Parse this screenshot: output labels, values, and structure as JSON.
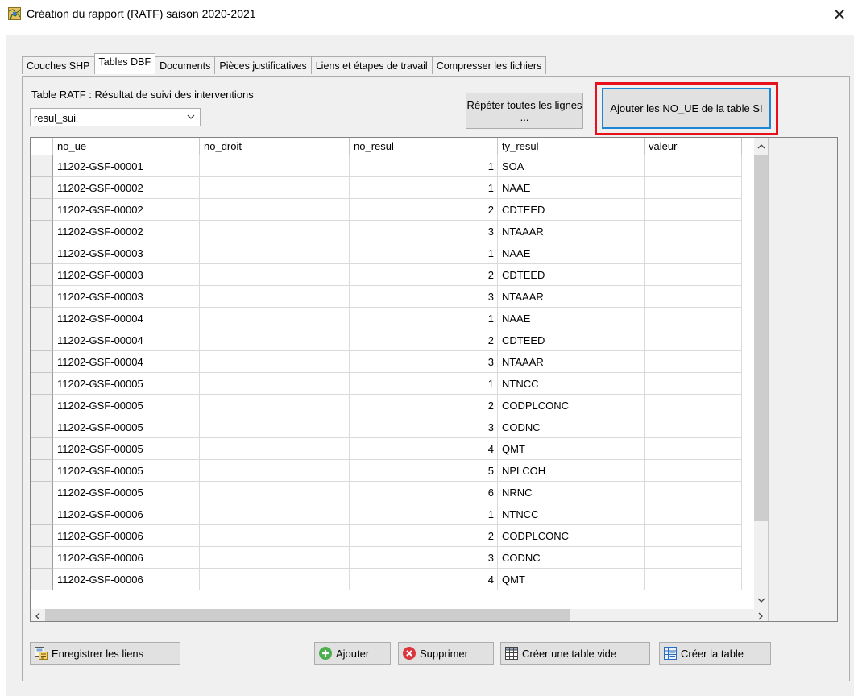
{
  "window": {
    "title": "Création du rapport (RATF)  saison 2020-2021",
    "icon": "app-map-icon",
    "close_glyph": "✕"
  },
  "tabs": [
    {
      "label": "Couches SHP",
      "active": false
    },
    {
      "label": "Tables DBF",
      "active": true
    },
    {
      "label": "Documents",
      "active": false
    },
    {
      "label": "Pièces justificatives",
      "active": false
    },
    {
      "label": "Liens et étapes de travail",
      "active": false
    },
    {
      "label": "Compresser les fichiers",
      "active": false
    }
  ],
  "panel": {
    "table_label": "Table RATF :  Résultat de suivi des interventions",
    "combo_value": "resul_sui",
    "repeat_button": "Répéter toutes les lignes ...",
    "add_noue_button": "Ajouter les NO_UE de la table SI",
    "highlight_color": "#e8101b"
  },
  "grid": {
    "columns": [
      "no_ue",
      "no_droit",
      "no_resul",
      "ty_resul",
      "valeur"
    ],
    "rows": [
      [
        "11202-GSF-00001",
        "",
        "1",
        "SOA",
        ""
      ],
      [
        "11202-GSF-00002",
        "",
        "1",
        "NAAE",
        ""
      ],
      [
        "11202-GSF-00002",
        "",
        "2",
        "CDTEED",
        ""
      ],
      [
        "11202-GSF-00002",
        "",
        "3",
        "NTAAAR",
        ""
      ],
      [
        "11202-GSF-00003",
        "",
        "1",
        "NAAE",
        ""
      ],
      [
        "11202-GSF-00003",
        "",
        "2",
        "CDTEED",
        ""
      ],
      [
        "11202-GSF-00003",
        "",
        "3",
        "NTAAAR",
        ""
      ],
      [
        "11202-GSF-00004",
        "",
        "1",
        "NAAE",
        ""
      ],
      [
        "11202-GSF-00004",
        "",
        "2",
        "CDTEED",
        ""
      ],
      [
        "11202-GSF-00004",
        "",
        "3",
        "NTAAAR",
        ""
      ],
      [
        "11202-GSF-00005",
        "",
        "1",
        "NTNCC",
        ""
      ],
      [
        "11202-GSF-00005",
        "",
        "2",
        "CODPLCONC",
        ""
      ],
      [
        "11202-GSF-00005",
        "",
        "3",
        "CODNC",
        ""
      ],
      [
        "11202-GSF-00005",
        "",
        "4",
        "QMT",
        ""
      ],
      [
        "11202-GSF-00005",
        "",
        "5",
        "NPLCOH",
        ""
      ],
      [
        "11202-GSF-00005",
        "",
        "6",
        "NRNC",
        ""
      ],
      [
        "11202-GSF-00006",
        "",
        "1",
        "NTNCC",
        ""
      ],
      [
        "11202-GSF-00006",
        "",
        "2",
        "CODPLCONC",
        ""
      ],
      [
        "11202-GSF-00006",
        "",
        "3",
        "CODNC",
        ""
      ],
      [
        "11202-GSF-00006",
        "",
        "4",
        "QMT",
        ""
      ]
    ]
  },
  "buttons": {
    "save_links": "Enregistrer les liens",
    "add": "Ajouter",
    "delete": "Supprimer",
    "create_empty": "Créer une table vide",
    "create_table": "Créer la table"
  }
}
